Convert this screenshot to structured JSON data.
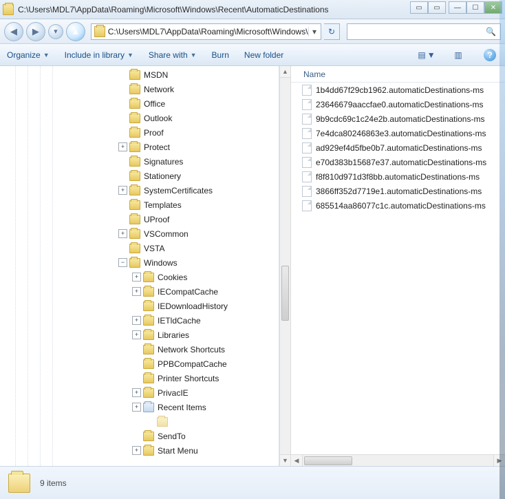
{
  "window": {
    "title": "C:\\Users\\MDL7\\AppData\\Roaming\\Microsoft\\Windows\\Recent\\AutomaticDestinations"
  },
  "address": {
    "path": "C:\\Users\\MDL7\\AppData\\Roaming\\Microsoft\\Windows\\",
    "dropdown_glyph": "▾",
    "refresh_glyph": "↻",
    "search_glyph": "🔍"
  },
  "nav": {
    "back_glyph": "◀",
    "fwd_glyph": "▶",
    "history_glyph": "▾",
    "up_glyph": "▲"
  },
  "toolbar": {
    "organize": "Organize",
    "include": "Include in library",
    "share": "Share with",
    "burn": "Burn",
    "newfolder": "New folder",
    "dd": "▼",
    "view_glyph": "▤",
    "preview_glyph": "▥",
    "help_glyph": "?"
  },
  "tree": [
    {
      "indent": 172,
      "tw": "",
      "label": "MSDN"
    },
    {
      "indent": 172,
      "tw": "",
      "label": "Network"
    },
    {
      "indent": 172,
      "tw": "",
      "label": "Office"
    },
    {
      "indent": 172,
      "tw": "",
      "label": "Outlook"
    },
    {
      "indent": 172,
      "tw": "",
      "label": "Proof"
    },
    {
      "indent": 172,
      "tw": "+",
      "label": "Protect"
    },
    {
      "indent": 172,
      "tw": "",
      "label": "Signatures"
    },
    {
      "indent": 172,
      "tw": "",
      "label": "Stationery"
    },
    {
      "indent": 172,
      "tw": "+",
      "label": "SystemCertificates"
    },
    {
      "indent": 172,
      "tw": "",
      "label": "Templates"
    },
    {
      "indent": 172,
      "tw": "",
      "label": "UProof"
    },
    {
      "indent": 172,
      "tw": "+",
      "label": "VSCommon"
    },
    {
      "indent": 172,
      "tw": "",
      "label": "VSTA"
    },
    {
      "indent": 172,
      "tw": "−",
      "label": "Windows"
    },
    {
      "indent": 192,
      "tw": "+",
      "label": "Cookies"
    },
    {
      "indent": 192,
      "tw": "+",
      "label": "IECompatCache"
    },
    {
      "indent": 192,
      "tw": "",
      "label": "IEDownloadHistory"
    },
    {
      "indent": 192,
      "tw": "+",
      "label": "IETldCache"
    },
    {
      "indent": 192,
      "tw": "+",
      "label": "Libraries"
    },
    {
      "indent": 192,
      "tw": "",
      "label": "Network Shortcuts"
    },
    {
      "indent": 192,
      "tw": "",
      "label": "PPBCompatCache"
    },
    {
      "indent": 192,
      "tw": "",
      "label": "Printer Shortcuts"
    },
    {
      "indent": 192,
      "tw": "+",
      "label": "PrivacIE"
    },
    {
      "indent": 192,
      "tw": "+",
      "label": "Recent Items",
      "icon": "recent"
    },
    {
      "indent": 212,
      "tw": "",
      "label": "",
      "icon": "faded"
    },
    {
      "indent": 192,
      "tw": "",
      "label": "SendTo"
    },
    {
      "indent": 192,
      "tw": "+",
      "label": "Start Menu"
    }
  ],
  "filelist": {
    "column": "Name",
    "items": [
      "1b4dd67f29cb1962.automaticDestinations-ms",
      "23646679aaccfae0.automaticDestinations-ms",
      "9b9cdc69c1c24e2b.automaticDestinations-ms",
      "7e4dca80246863e3.automaticDestinations-ms",
      "ad929ef4d5fbe0b7.automaticDestinations-ms",
      "e70d383b15687e37.automaticDestinations-ms",
      "f8f810d971d3f8bb.automaticDestinations-ms",
      "3866ff352d7719e1.automaticDestinations-ms",
      "685514aa86077c1c.automaticDestinations-ms"
    ]
  },
  "status": {
    "text": "9 items"
  },
  "scroll": {
    "up": "▲",
    "down": "▼",
    "left": "◀",
    "right": "▶"
  }
}
